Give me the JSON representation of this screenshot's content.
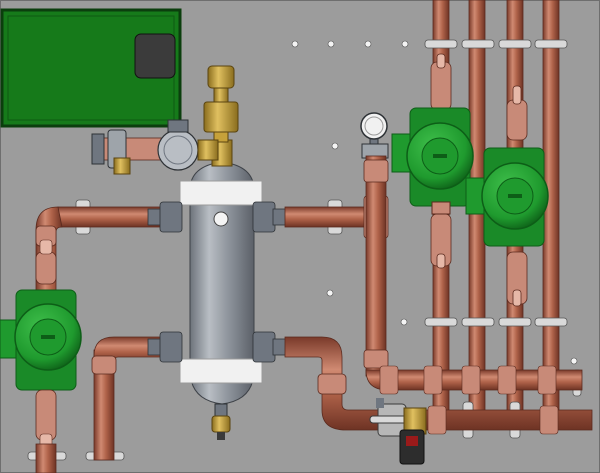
{
  "scene": {
    "kind": "hydronic-piping-cad-rendering",
    "colors": {
      "board": "#9c9c9c",
      "board_edge": "#6e6e6e",
      "copper": "#b0634a",
      "copper_dark": "#7a3a2a",
      "copper_light": "#d08a72",
      "pump_green": "#1f9a2e",
      "pump_green_dark": "#0d5e17",
      "pump_green_light": "#3fbf4b",
      "control_box": "#167a1a",
      "control_box_edge": "#0b3e0d",
      "separator_body": "#8e949c",
      "separator_light": "#b9bec4",
      "insulation_band": "#f1f1f1",
      "brass": "#c6a13a",
      "brass_dark": "#8a6d1e",
      "union_nut": "#6f7680",
      "valve_handle": "#2d2d2d",
      "clamp": "#d9d9d9",
      "hole": "#f4f4f4"
    },
    "components": [
      "control-box",
      "hydraulic-separator",
      "circulation-pump",
      "expansion-valve-assembly",
      "air-vent",
      "pressure-gauge",
      "ball-valve",
      "drain-valve"
    ]
  }
}
